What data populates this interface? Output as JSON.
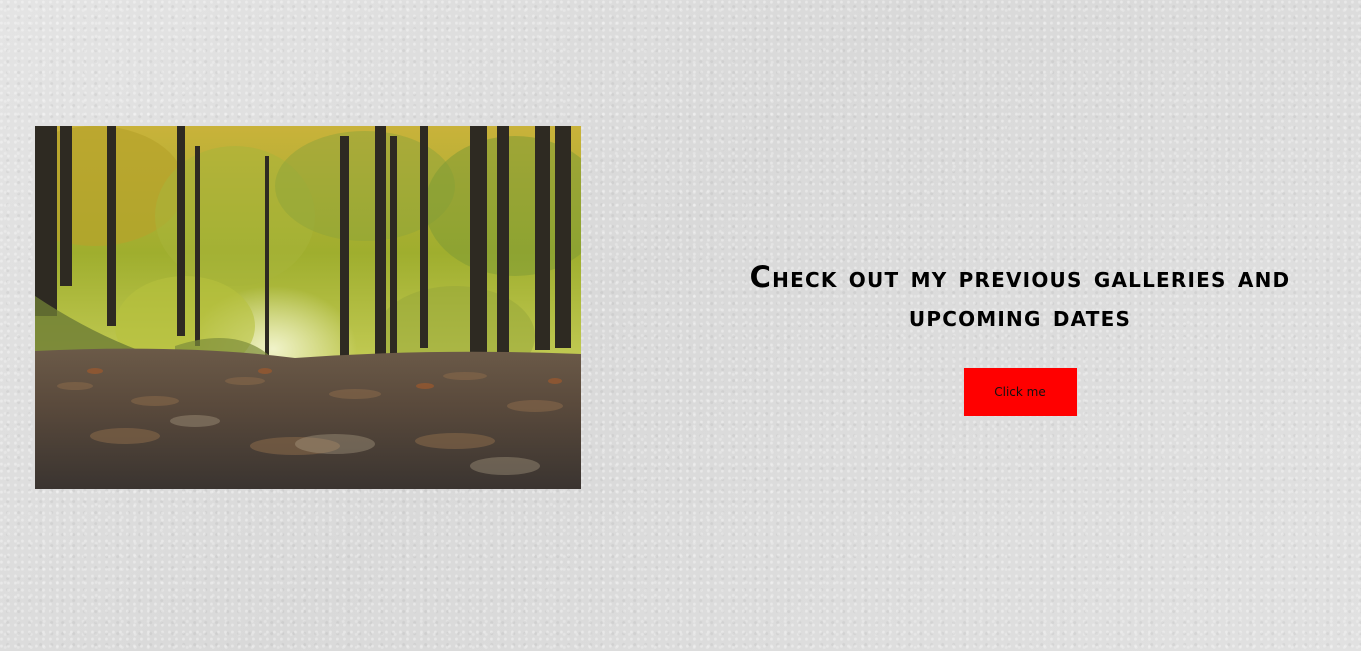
{
  "hero": {
    "image_name": "forest-path-photo"
  },
  "cta": {
    "heading": "Check out my previous galleries and upcoming dates",
    "button_label": "Click me"
  },
  "colors": {
    "background": "#dedede",
    "button": "#ff0000",
    "heading": "#000000"
  }
}
